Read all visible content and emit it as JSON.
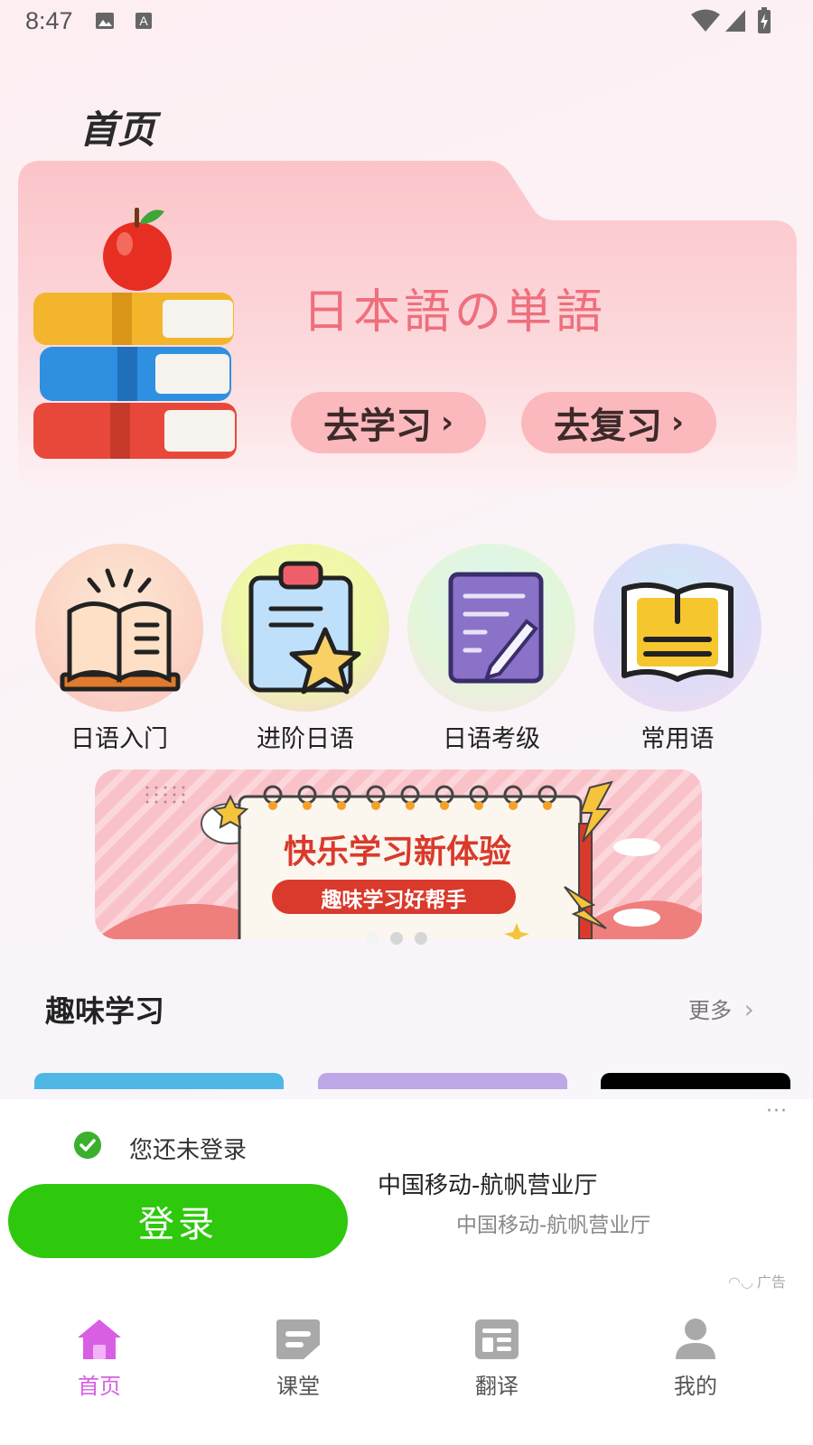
{
  "status_bar": {
    "time": "8:47",
    "icons": [
      "image-icon",
      "a-icon",
      "wifi-icon",
      "signal-icon",
      "battery-icon"
    ]
  },
  "page": {
    "title": "首页"
  },
  "hero": {
    "title": "日本語の単語",
    "buttons": [
      {
        "label": "去学习",
        "chevron": "›"
      },
      {
        "label": "去复习",
        "chevron": "›"
      }
    ]
  },
  "categories": [
    {
      "label": "日语入门",
      "icon": "open-book-icon"
    },
    {
      "label": "进阶日语",
      "icon": "clipboard-star-icon"
    },
    {
      "label": "日语考级",
      "icon": "notepad-pencil-icon"
    },
    {
      "label": "常用语",
      "icon": "book-icon"
    }
  ],
  "banner": {
    "title": "快乐学习新体验",
    "subtitle": "趣味学习好帮手",
    "slide_count": 3,
    "active_slide": 1
  },
  "section": {
    "title": "趣味学习",
    "more": "更多"
  },
  "ad": {
    "login_hint": "您还未登录",
    "login_button": "登录",
    "title": "中国移动-航帆营业厅",
    "subtitle": "中国移动-航帆营业厅",
    "badge": "广告",
    "menu": "···"
  },
  "nav": {
    "items": [
      {
        "label": "首页",
        "icon": "home-icon",
        "active": true
      },
      {
        "label": "课堂",
        "icon": "classroom-icon",
        "active": false
      },
      {
        "label": "翻译",
        "icon": "translate-icon",
        "active": false
      },
      {
        "label": "我的",
        "icon": "profile-icon",
        "active": false
      }
    ]
  },
  "colors": {
    "accent_pink": "#ef6f7d",
    "pill_pink": "#fbb9bd",
    "login_green": "#2ec80c",
    "nav_active": "#d85fe4"
  }
}
